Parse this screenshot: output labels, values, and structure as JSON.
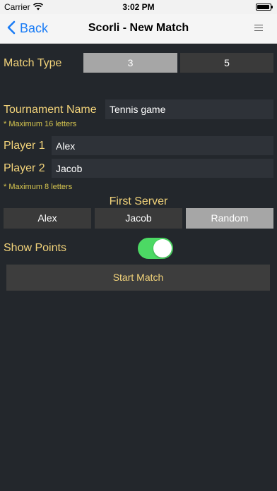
{
  "status": {
    "carrier": "Carrier",
    "time": "3:02 PM"
  },
  "nav": {
    "back_label": "Back",
    "title": "Scorli - New Match"
  },
  "match_type": {
    "label": "Match Type",
    "options": [
      "3",
      "5"
    ],
    "selected": "3"
  },
  "tournament": {
    "label": "Tournament Name",
    "value": "Tennis game",
    "hint": "* Maximum 16 letters"
  },
  "player1": {
    "label": "Player 1",
    "value": "Alex"
  },
  "player2": {
    "label": "Player 2",
    "value": "Jacob"
  },
  "players_hint": "* Maximum 8 letters",
  "first_server": {
    "label": "First Server",
    "options": [
      "Alex",
      "Jacob",
      "Random"
    ],
    "selected": "Random"
  },
  "show_points": {
    "label": "Show Points",
    "on": true
  },
  "start_button": "Start Match",
  "colors": {
    "accent": "#f2d37a",
    "hint": "#d7c64f",
    "toggle_on": "#4cd964",
    "ios_blue": "#1a7cf5"
  }
}
